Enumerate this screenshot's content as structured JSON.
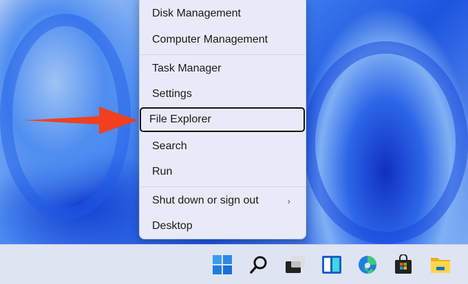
{
  "menu": {
    "items": [
      {
        "label": "Disk Management"
      },
      {
        "label": "Computer Management"
      },
      {
        "label": "Task Manager"
      },
      {
        "label": "Settings"
      },
      {
        "label": "File Explorer"
      },
      {
        "label": "Search"
      },
      {
        "label": "Run"
      },
      {
        "label": "Shut down or sign out",
        "chevron": "›"
      },
      {
        "label": "Desktop"
      }
    ]
  },
  "colors": {
    "arrow": "#f0401e",
    "menu_bg": "#e8ebf7",
    "taskbar_bg": "#dfe4f3"
  },
  "taskbar": {
    "icons": [
      "windows-start-icon",
      "search-icon",
      "task-view-icon",
      "widgets-icon",
      "edge-icon",
      "store-icon",
      "file-explorer-icon"
    ]
  }
}
